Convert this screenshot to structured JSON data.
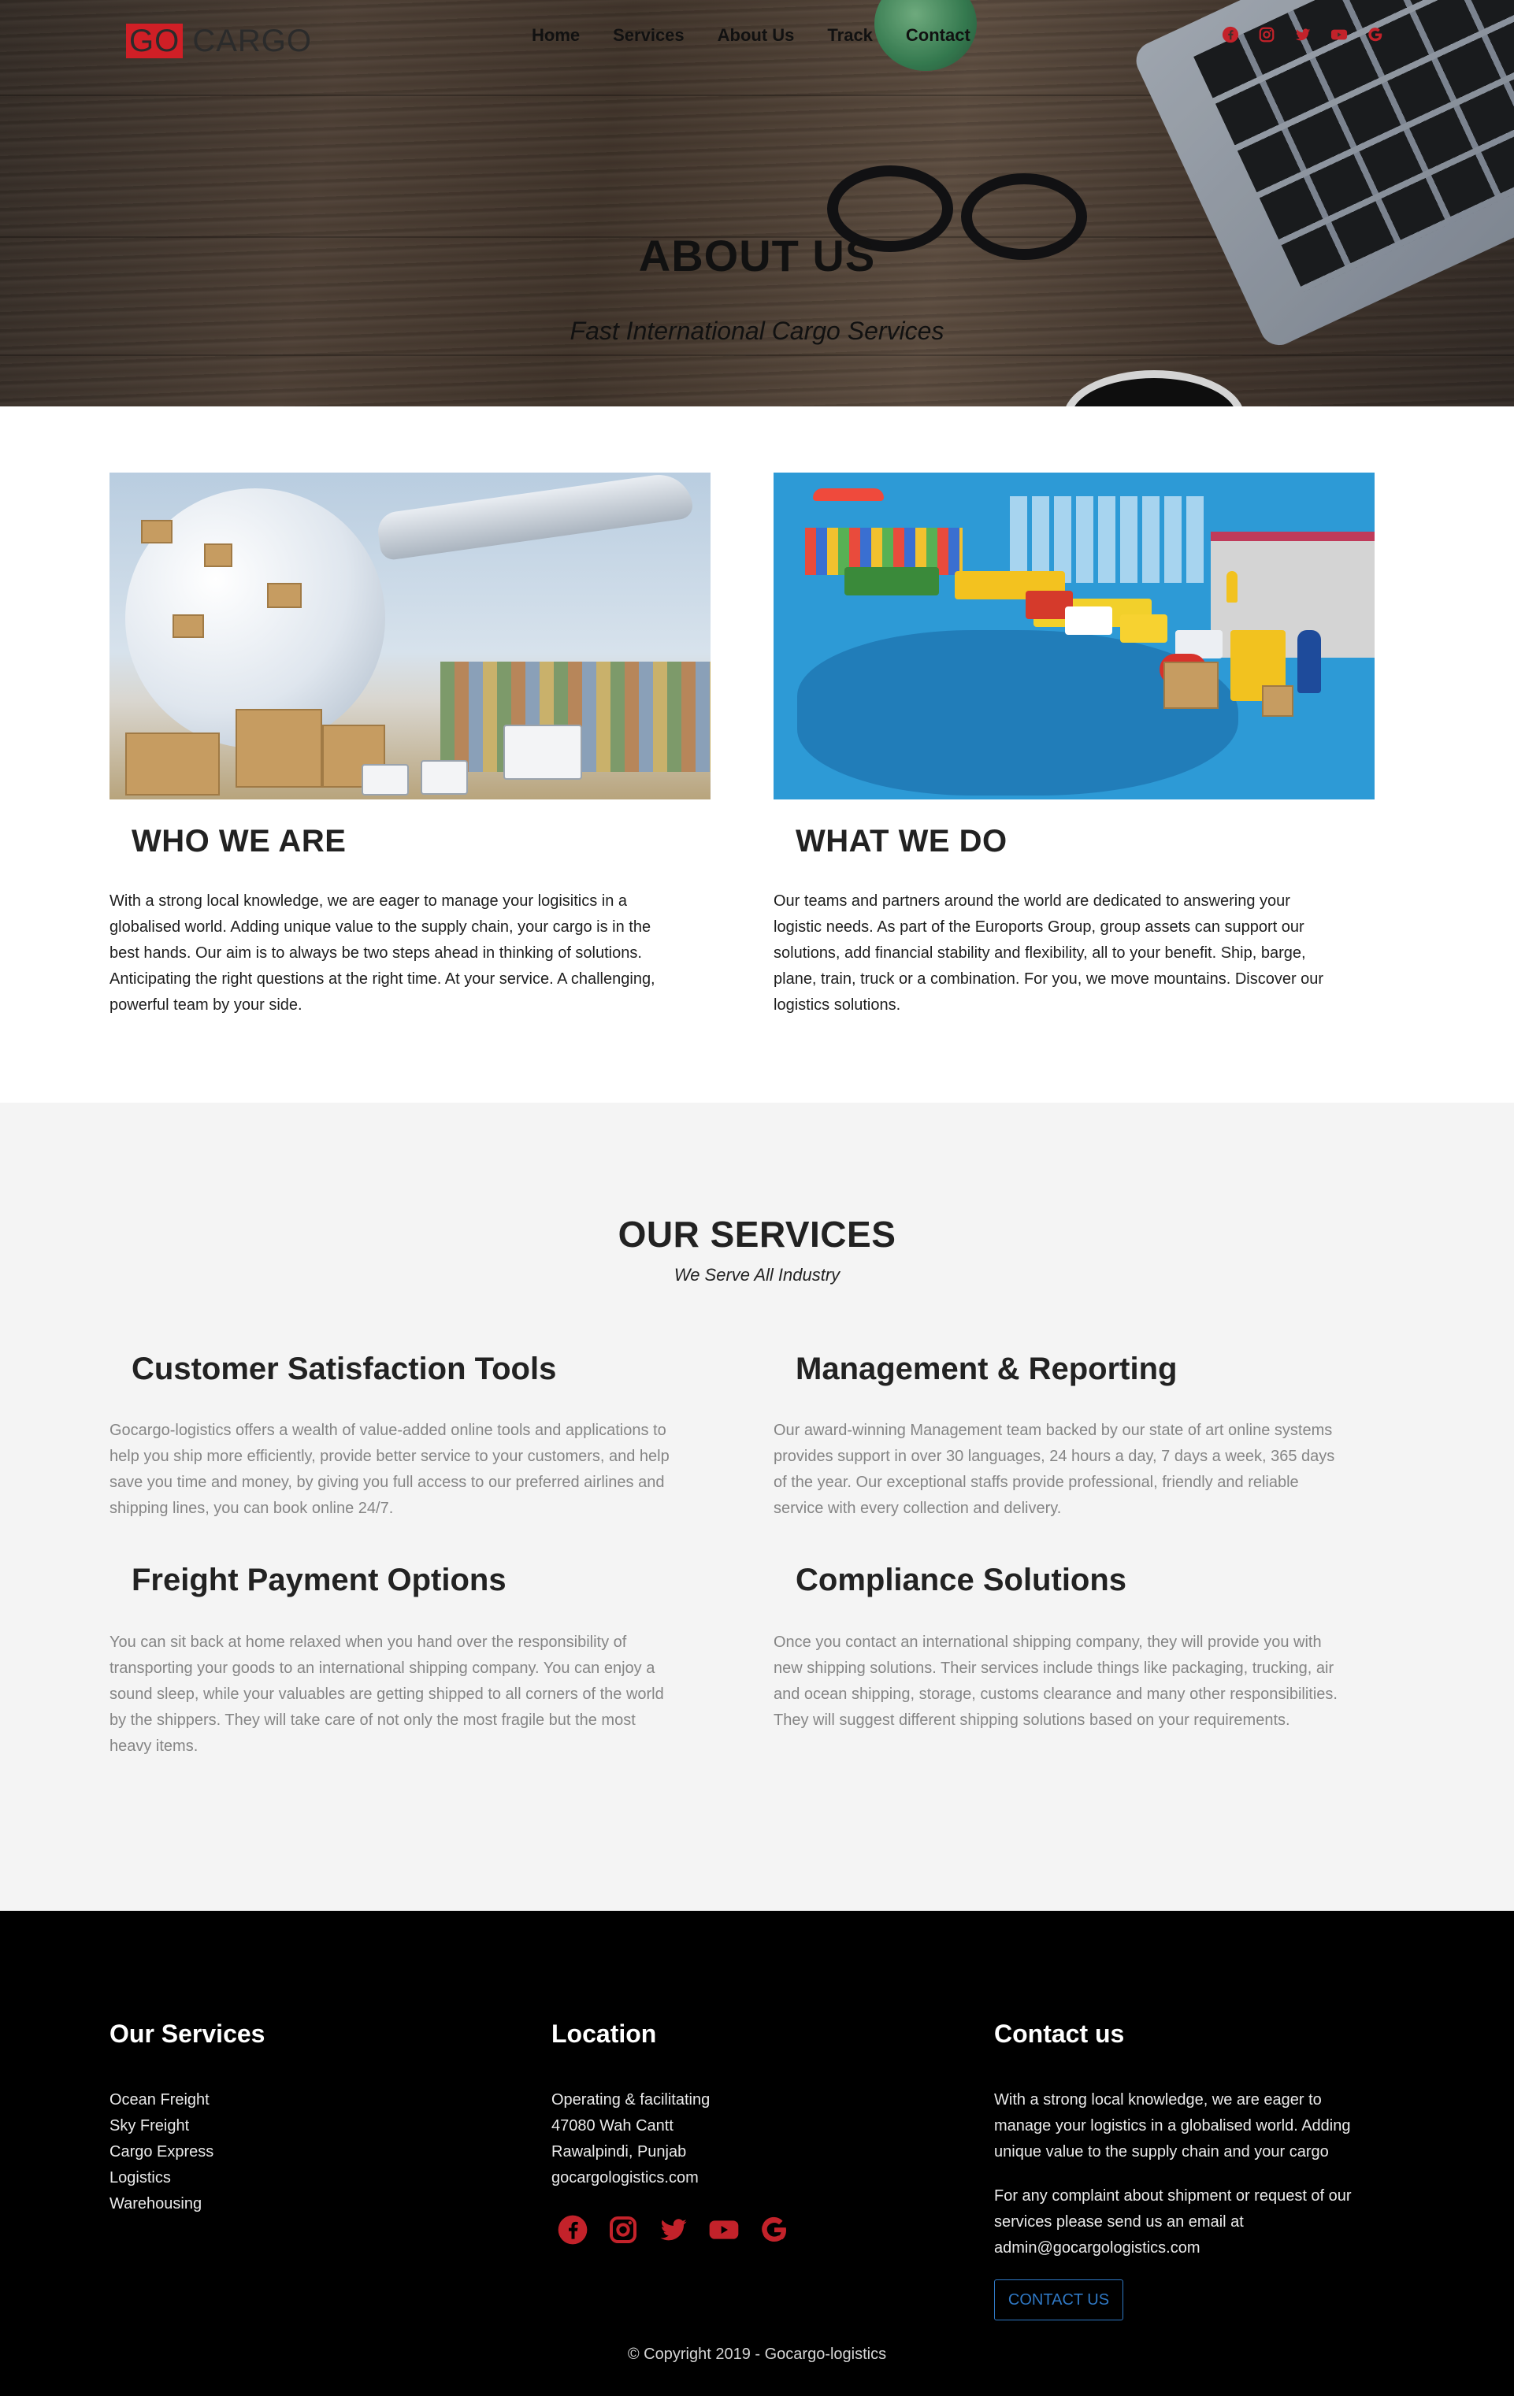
{
  "brand": {
    "logo_go": "GO",
    "logo_rest": " CARGO",
    "accent_color": "#d01f26"
  },
  "nav": {
    "items": [
      "Home",
      "Services",
      "About Us",
      "Track",
      "Contact"
    ]
  },
  "social_icons": [
    "facebook-icon",
    "instagram-icon",
    "twitter-icon",
    "youtube-icon",
    "google-icon"
  ],
  "hero": {
    "title": "ABOUT US",
    "subtitle": "Fast International Cargo Services"
  },
  "about": {
    "who": {
      "heading": "WHO WE ARE",
      "lines": [
        "With a strong local knowledge, we are eager to manage your logisitics in a",
        "globalised world. Adding unique value to the supply chain, your cargo is in the",
        "best hands. Our aim is to always be two steps ahead in thinking of solutions.",
        "Anticipating the right questions at the right time. At your service. A challenging,",
        "powerful team by your side."
      ]
    },
    "what": {
      "heading": "WHAT WE DO",
      "lines": [
        "Our teams and partners around the world are dedicated to answering your",
        "logistic needs. As part of the Euroports Group, group assets can support our",
        "solutions, add financial stability and flexibility, all to your benefit. Ship, barge,",
        "plane, train, truck or a combination. For you, we move mountains. Discover our",
        "logistics solutions."
      ]
    }
  },
  "services": {
    "title": "OUR SERVICES",
    "subtitle": "We Serve All Industry",
    "items": [
      {
        "heading": "Customer Satisfaction Tools",
        "lines": [
          "Gocargo-logistics offers a wealth of value-added online tools and applications to",
          "help you ship more efficiently, provide better service to your customers, and help",
          "save you time and money, by giving you full access to our preferred airlines and",
          "shipping lines, you can book online 24/7."
        ]
      },
      {
        "heading": "Management & Reporting",
        "lines": [
          "Our award-winning Management team backed by our state of art online systems",
          "provides support in over 30 languages, 24 hours a day, 7 days a week, 365 days",
          "of the year. Our exceptional staffs provide professional, friendly and reliable",
          "service with every collection and delivery."
        ]
      },
      {
        "heading": "Freight Payment Options",
        "lines": [
          "You can sit back at home relaxed when you hand over the responsibility of",
          "transporting your goods to an international shipping company. You can enjoy a",
          "sound sleep, while your valuables are getting shipped to all corners of the world",
          "by the shippers. They will take care of not only the most fragile but the most",
          "heavy items."
        ]
      },
      {
        "heading": "Compliance Solutions",
        "lines": [
          "Once you contact an international shipping company, they will provide you with",
          "new shipping solutions. Their services include things like packaging, trucking, air",
          "and ocean shipping, storage, customs clearance and many other responsibilities.",
          "They will suggest different shipping solutions based on your requirements."
        ]
      }
    ]
  },
  "footer": {
    "services": {
      "heading": "Our Services",
      "items": [
        "Ocean Freight",
        "Sky Freight",
        "Cargo Express",
        "Logistics",
        "Warehousing"
      ]
    },
    "location": {
      "heading": "Location",
      "items": [
        "Operating & facilitating",
        "47080 Wah Cantt",
        "Rawalpindi, Punjab",
        "gocargologistics.com"
      ]
    },
    "contact": {
      "heading": "Contact us",
      "para1": [
        "With a strong local knowledge, we are eager to",
        "manage your logistics in a globalised world. Adding",
        "unique value to the supply chain and your cargo"
      ],
      "para2": [
        "For any complaint about shipment or request of our",
        "services please send us an email at",
        "admin@gocargologistics.com"
      ],
      "button": "CONTACT US"
    },
    "copyright": "© Copyright 2019 - Gocargo-logistics"
  }
}
